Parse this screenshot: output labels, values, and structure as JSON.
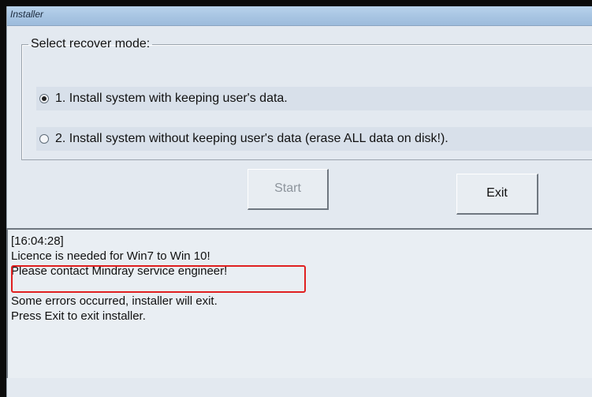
{
  "window": {
    "title": "Installer"
  },
  "mode_group": {
    "legend": "Select recover mode:",
    "options": [
      {
        "label": "1. Install system with keeping user's data.",
        "selected": true
      },
      {
        "label": "2. Install system without keeping user's data (erase ALL data on disk!).",
        "selected": false
      }
    ]
  },
  "buttons": {
    "start_label": "Start",
    "start_enabled": false,
    "exit_label": "Exit"
  },
  "log": {
    "lines": [
      "[16:04:28]",
      "Licence is needed for Win7 to Win 10!",
      "Please contact Mindray service engineer!",
      "",
      "Some errors occurred, installer will exit.",
      "Press Exit to exit installer."
    ]
  },
  "colors": {
    "highlight_box": "#e02020",
    "titlebar": "#a7c4e2",
    "background": "#e3e9f0"
  }
}
